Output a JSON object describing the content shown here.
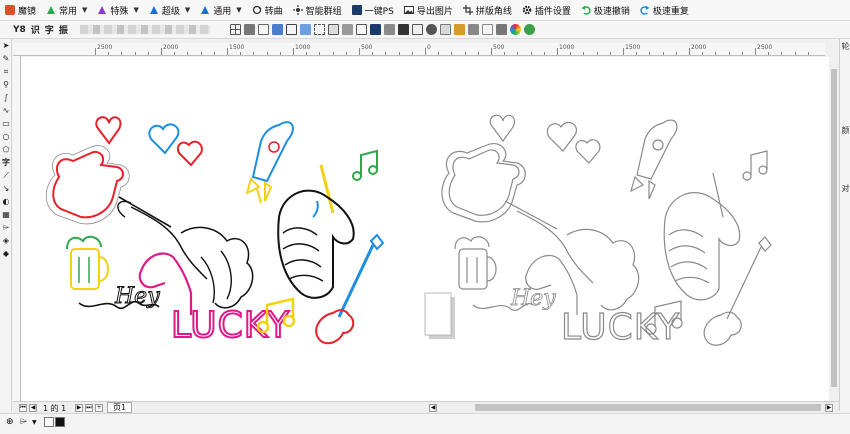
{
  "plugin_bar": {
    "items": [
      {
        "label": "魔镜",
        "icon": "magic-mirror-icon"
      },
      {
        "label": "常用",
        "icon": "common-icon",
        "dropdown": true
      },
      {
        "label": "特殊",
        "icon": "special-icon",
        "dropdown": true
      },
      {
        "label": "超级",
        "icon": "super-icon",
        "dropdown": true
      },
      {
        "label": "通用",
        "icon": "general-icon",
        "dropdown": true
      },
      {
        "label": "转曲",
        "icon": "convert-curve-icon"
      },
      {
        "label": "智能群组",
        "icon": "smart-group-icon"
      },
      {
        "label": "一键PS",
        "icon": "one-click-ps-icon"
      },
      {
        "label": "导出图片",
        "icon": "export-image-icon"
      },
      {
        "label": "拼版角线",
        "icon": "imposition-cropmark-icon"
      },
      {
        "label": "插件设置",
        "icon": "gear-icon"
      },
      {
        "label": "极速撤销",
        "icon": "undo-icon"
      },
      {
        "label": "极速重复",
        "icon": "redo-icon"
      }
    ]
  },
  "tool_bar": {
    "text_buttons": [
      "Y8",
      "识",
      "字",
      "振"
    ]
  },
  "ruler": {
    "top_ticks": [
      "2500",
      "2000",
      "1500",
      "1000",
      "500",
      "0",
      "500",
      "1000",
      "1500",
      "2000",
      "2500"
    ]
  },
  "page_bar": {
    "page_counter": "1 的 1",
    "page_tab": "页1"
  },
  "docker": {
    "labels": [
      "轮",
      "颜",
      "对"
    ]
  },
  "colors": {
    "red": "#e8202a",
    "blue": "#1d8fe0",
    "yellow": "#f3d214",
    "green": "#2da84a",
    "magenta": "#e0188a",
    "purple": "#8e3cc7",
    "outline_gray": "#8a8a8a"
  },
  "artwork": {
    "left_text": "LUCKY",
    "left_script": "Hey",
    "right_text": "LUCKY",
    "right_script": "Hey"
  }
}
